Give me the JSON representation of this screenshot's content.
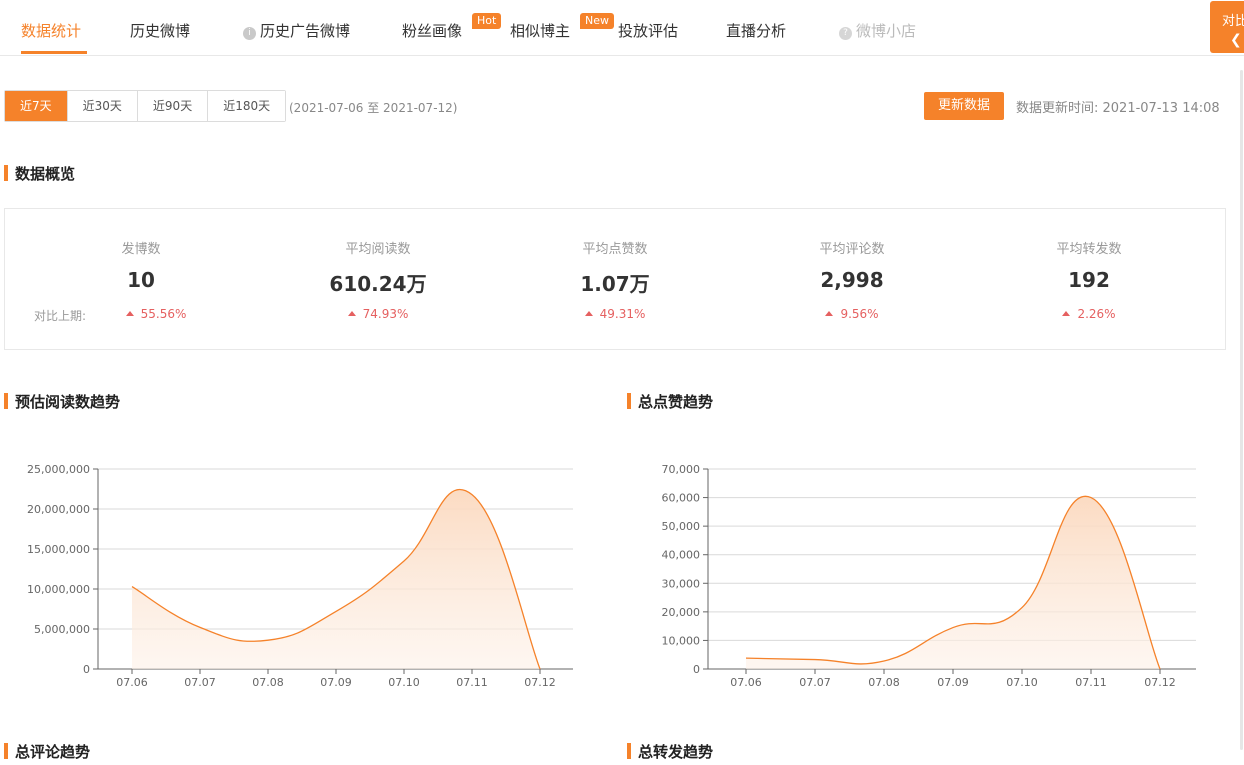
{
  "nav": {
    "tabs": [
      {
        "label": "数据统计"
      },
      {
        "label": "历史微博"
      },
      {
        "label": "历史广告微博"
      },
      {
        "label": "粉丝画像",
        "badge": "Hot"
      },
      {
        "label": "相似博主",
        "badge": "New"
      },
      {
        "label": "投放评估"
      },
      {
        "label": "直播分析"
      },
      {
        "label": "微博小店"
      }
    ],
    "compare_label": "对比"
  },
  "toolbar": {
    "ranges": [
      "近7天",
      "近30天",
      "近90天",
      "近180天"
    ],
    "date_range": "(2021-07-06 至 2021-07-12)",
    "update_button": "更新数据",
    "update_time": "数据更新时间: 2021-07-13 14:08"
  },
  "overview": {
    "title": "数据概览",
    "compare_label": "对比上期:",
    "metrics": [
      {
        "label": "发博数",
        "value": "10",
        "change": "55.56%"
      },
      {
        "label": "平均阅读数",
        "value": "610.24万",
        "change": "74.93%"
      },
      {
        "label": "平均点赞数",
        "value": "1.07万",
        "change": "49.31%"
      },
      {
        "label": "平均评论数",
        "value": "2,998",
        "change": "9.56%"
      },
      {
        "label": "平均转发数",
        "value": "192",
        "change": "2.26%"
      }
    ]
  },
  "sections": {
    "comments_title": "总评论趋势",
    "forwards_title": "总转发趋势"
  },
  "colors": {
    "accent": "#f5822a",
    "up": "#e56060"
  },
  "chart_data": [
    {
      "type": "area",
      "title": "预估阅读数趋势",
      "categories": [
        "07.06",
        "07.07",
        "07.08",
        "07.09",
        "07.10",
        "07.11",
        "07.12"
      ],
      "series": [
        {
          "values": [
            10300000,
            5200000,
            3600000,
            7200000,
            13500000,
            21800000,
            0
          ]
        }
      ],
      "ylim": [
        0,
        25000000
      ],
      "yticks": [
        {
          "v": 0,
          "label": "0"
        },
        {
          "v": 5000000,
          "label": "5,000,000"
        },
        {
          "v": 10000000,
          "label": "10,000,000"
        },
        {
          "v": 15000000,
          "label": "15,000,000"
        },
        {
          "v": 20000000,
          "label": "20,000,000"
        },
        {
          "v": 25000000,
          "label": "25,000,000"
        }
      ],
      "grid": true
    },
    {
      "type": "area",
      "title": "总点赞趋势",
      "categories": [
        "07.06",
        "07.07",
        "07.08",
        "07.09",
        "07.10",
        "07.11",
        "07.12"
      ],
      "series": [
        {
          "values": [
            3800,
            3300,
            2800,
            14500,
            21500,
            60000,
            0
          ]
        }
      ],
      "ylim": [
        0,
        70000
      ],
      "yticks": [
        {
          "v": 0,
          "label": "0"
        },
        {
          "v": 10000,
          "label": "10,000"
        },
        {
          "v": 20000,
          "label": "20,000"
        },
        {
          "v": 30000,
          "label": "30,000"
        },
        {
          "v": 40000,
          "label": "40,000"
        },
        {
          "v": 50000,
          "label": "50,000"
        },
        {
          "v": 60000,
          "label": "60,000"
        },
        {
          "v": 70000,
          "label": "70,000"
        }
      ],
      "grid": true
    }
  ]
}
